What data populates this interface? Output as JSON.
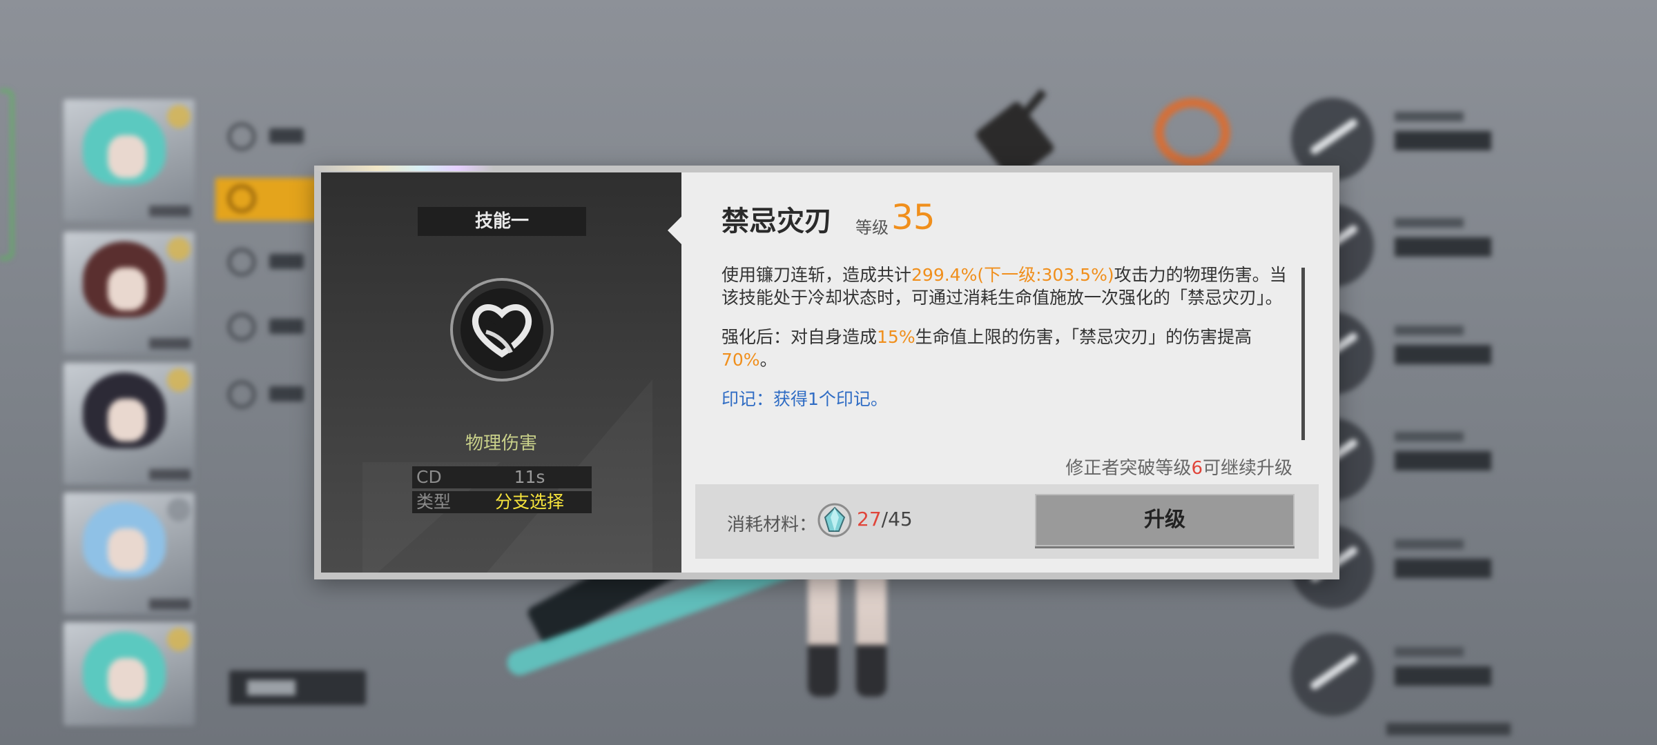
{
  "dialog": {
    "skill_slot_label": "技能一",
    "damage_type": "物理伤害",
    "stats": [
      {
        "key": "CD",
        "value": "11s",
        "value_color": "#9a9a9a"
      },
      {
        "key": "类型",
        "value": "分支选择",
        "value_color": "#f6e43c"
      }
    ],
    "skill_name": "禁忌灾刃",
    "level_label": "等级",
    "level_value": "35",
    "description": {
      "p1_a": "使用镰刀连斩，造成共计",
      "p1_b": "299.4%(下一级:303.5%)",
      "p1_c": "攻击力的物理伤害。当该技能处于冷却状态时，可通过消耗生命值施放一次强化的「禁忌灾刃」。",
      "p2_a": "强化后：对自身造成",
      "p2_b": "15%",
      "p2_c": "生命值上限的伤害，「禁忌灾刃」的伤害提高",
      "p2_d": "70%",
      "p2_e": "。",
      "p3": "印记：获得1个印记。"
    },
    "upgrade_note_a": "修正者突破等级",
    "upgrade_note_b": "6",
    "upgrade_note_c": "可继续升级",
    "cost_label": "消耗材料：",
    "cost_have": "27",
    "cost_sep": "/",
    "cost_need": "45",
    "upgrade_button": "升级",
    "accent_orange": "#f08f1c",
    "accent_red": "#e0453a"
  }
}
